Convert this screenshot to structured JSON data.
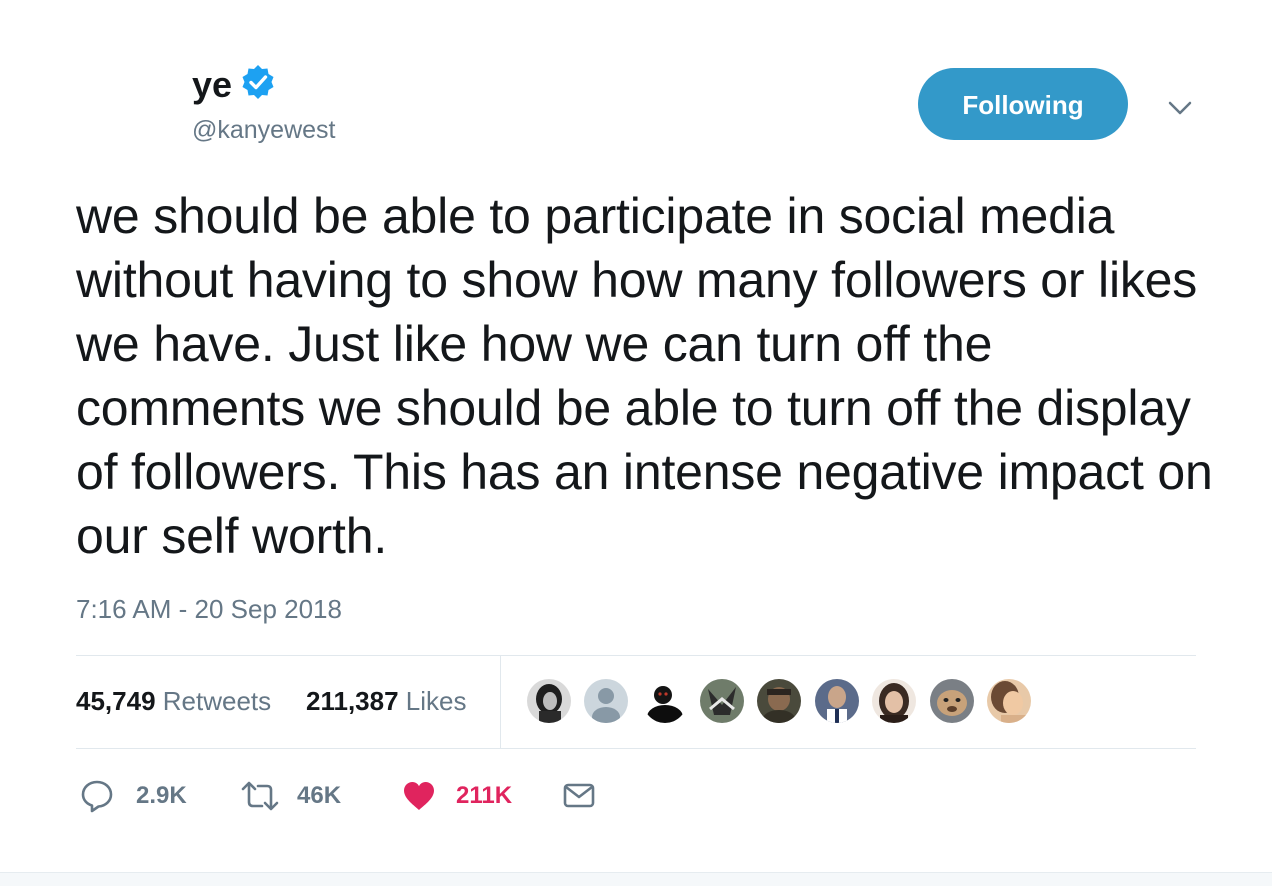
{
  "author": {
    "display_name": "ye",
    "username": "@kanyewest",
    "verified": true
  },
  "follow_button": {
    "label": "Following",
    "color": "#3399c9"
  },
  "tweet": {
    "text": "we should be able to participate in social media without having to show how many followers or likes we have. Just like how we can turn off the comments we should be able to turn off the display of followers. This has an intense negative impact on our self worth.",
    "timestamp": "7:16 AM - 20 Sep 2018"
  },
  "stats": {
    "retweets_count": "45,749",
    "retweets_label": "Retweets",
    "likes_count": "211,387",
    "likes_label": "Likes"
  },
  "liked_by_avatars": [
    {
      "name": "avatar-1"
    },
    {
      "name": "avatar-default"
    },
    {
      "name": "avatar-3"
    },
    {
      "name": "avatar-4"
    },
    {
      "name": "avatar-5"
    },
    {
      "name": "avatar-6"
    },
    {
      "name": "avatar-7"
    },
    {
      "name": "avatar-8"
    },
    {
      "name": "avatar-9"
    }
  ],
  "actions": {
    "reply_count": "2.9K",
    "retweet_count": "46K",
    "like_count": "211K",
    "like_color": "#e0245e"
  },
  "icons": {
    "verified": "verified-badge-icon",
    "caret": "chevron-down-icon",
    "reply": "reply-icon",
    "retweet": "retweet-icon",
    "like": "heart-icon",
    "dm": "envelope-icon"
  }
}
